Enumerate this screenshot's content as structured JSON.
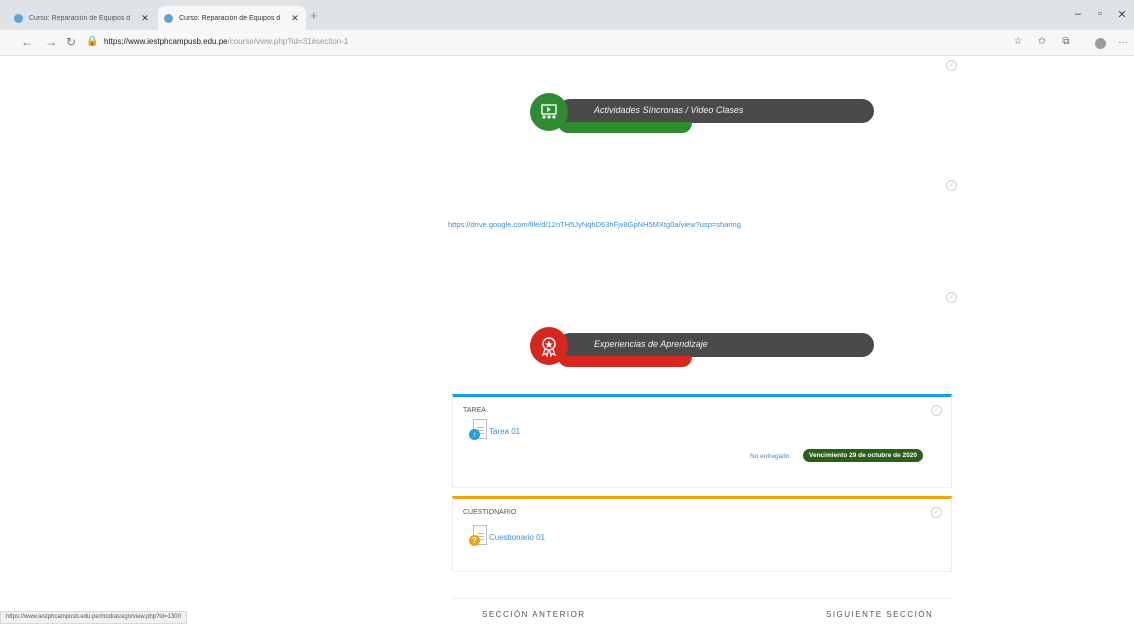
{
  "browser": {
    "tabs": [
      {
        "title": "Curso: Reparación de Equipos d"
      },
      {
        "title": "Curso: Reparación de Equipos d"
      }
    ],
    "url_host": "https://www.iestphcampusb.edu.pe",
    "url_path": "/course/view.php?id=31#section-1",
    "status_url": "https://www.iestphcampusb.edu.pe/mod/assign/view.php?id=1300"
  },
  "sections": {
    "sync": {
      "label": "Actividades Síncronas / Video Clases",
      "color": "#2e8b30"
    },
    "experiences": {
      "label": "Experiencias de Aprendizaje",
      "color": "#d7261e"
    }
  },
  "drive_link": "https://drive.google.com/file/d/12nTH5JyNqhD63hFjv8GpNH5MXtg0a/view?usp=sharing",
  "activities": [
    {
      "kind": "Tarea",
      "name": "Tarea 01",
      "status": "No entregado",
      "due": "Vencimiento 29 de octubre de 2020",
      "accent": "#1ba1e2"
    },
    {
      "kind": "Cuestionario",
      "name": "Cuestionario 01",
      "accent": "#f0a30a"
    }
  ],
  "nav": {
    "prev": "SECCIÓN ANTERIOR",
    "next": "SIGUIENTE SECCIÓN"
  },
  "icons": {
    "back": "arrow-left",
    "forward": "arrow-right",
    "refresh": "refresh",
    "lock": "lock",
    "favorite": "star",
    "collections": "collections",
    "profile": "avatar",
    "menu": "ellipsis"
  }
}
